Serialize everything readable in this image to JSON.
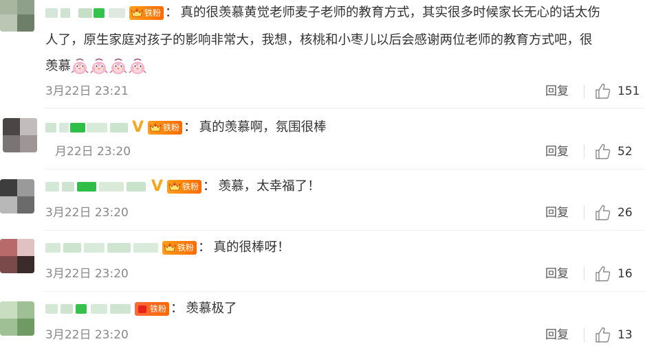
{
  "fan_badge_label": "铁粉",
  "reply_label": "回复",
  "comments": [
    {
      "user": "",
      "fan_level": "4",
      "text_line1": "真的很羡慕黄觉老师麦子老师的教育方式，其实很多时候家长无心的话太伤",
      "text_line2": "人了，原生家庭对孩子的影响非常大，我想，核桃和小枣儿以后会感谢两位老师的教育方式吧，很",
      "text_line3": "羡慕",
      "emoji_count": 4,
      "time": "3月22日 23:21",
      "likes": "151"
    },
    {
      "user": "",
      "verified": true,
      "fan_level": "3",
      "text": "真的羡慕啊，氛围很棒",
      "time": "月22日 23:20",
      "likes": "52"
    },
    {
      "user": "",
      "verified": true,
      "fan_level": "2",
      "text": "羡慕，太幸福了！",
      "time": "3月22日 23:20",
      "likes": "26"
    },
    {
      "user": "",
      "fan_level": "4",
      "text": "真的很棒呀！",
      "time": "3月22日 23:20",
      "likes": "16"
    },
    {
      "user": "",
      "fan_level": "",
      "text": "羡慕极了",
      "time": "3月22日 23:20",
      "likes": "13"
    }
  ],
  "colors": {
    "accent_orange": "#ff8200",
    "verified_v": "#f5a623",
    "meta_gray": "#888888"
  },
  "icons": [
    "thumbs-up-icon",
    "crown-icon",
    "verified-v-icon",
    "pink-bird-emoji"
  ]
}
